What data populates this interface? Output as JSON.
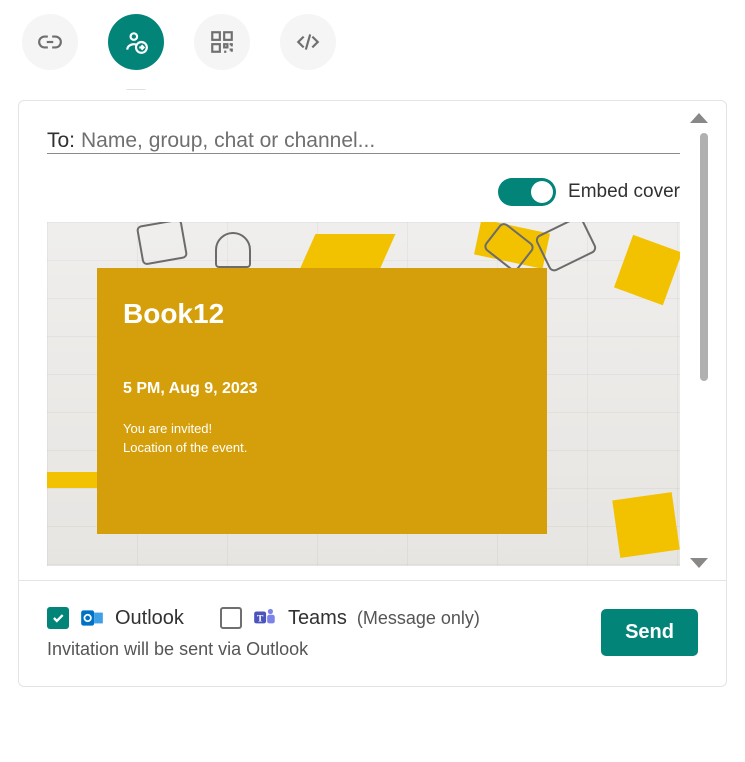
{
  "tabs": [
    {
      "name": "link",
      "icon": "link-icon"
    },
    {
      "name": "invite",
      "icon": "person-send-icon"
    },
    {
      "name": "qr",
      "icon": "qr-icon"
    },
    {
      "name": "embed",
      "icon": "code-icon"
    }
  ],
  "active_tab": "invite",
  "to_field": {
    "label": "To:",
    "placeholder": "Name, group, chat or channel..."
  },
  "embed_toggle": {
    "label": "Embed cover",
    "on": true
  },
  "cover": {
    "title": "Book12",
    "datetime": "5 PM, Aug 9, 2023",
    "line1": "You are invited!",
    "line2": "Location of the event."
  },
  "channels": {
    "outlook": {
      "label": "Outlook",
      "checked": true
    },
    "teams": {
      "label": "Teams",
      "checked": false
    },
    "message_only": "(Message only)"
  },
  "hint": "Invitation will be sent via Outlook",
  "send_button": "Send",
  "colors": {
    "brand": "#028479",
    "cover_card": "#d49f0b",
    "accent_yellow": "#f2c200"
  }
}
